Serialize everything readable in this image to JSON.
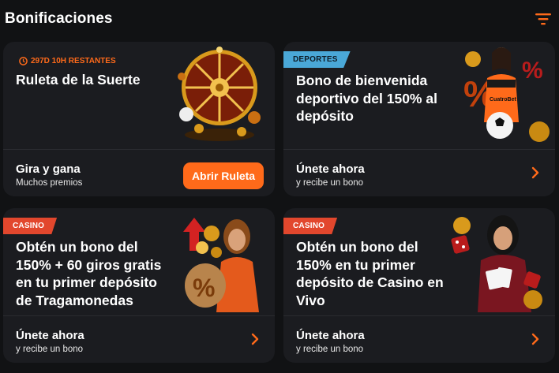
{
  "header": {
    "title": "Bonificaciones",
    "filter_icon": "filter-icon"
  },
  "colors": {
    "accent": "#ff6a1a",
    "sport_tag": "#4aa8d8",
    "casino_tag": "#e2472d",
    "card_bg": "#1b1c20",
    "page_bg": "#111214"
  },
  "cards": [
    {
      "timer": "297D 10H RESTANTES",
      "title_lines": [
        "Ruleta de la Suerte"
      ],
      "footer_main": "Gira y gana",
      "footer_sub": "Muchos premios",
      "button_label": "Abrir Ruleta",
      "image": "roulette-wheel"
    },
    {
      "tag": "DEPORTES",
      "title_lines": [
        "Bono de bienvenida",
        "deportivo del 150% al",
        "depósito"
      ],
      "footer_main": "Únete ahora",
      "footer_sub": "y recibe un bono",
      "image": "sports-woman",
      "jersey_text": "CuatroBet"
    },
    {
      "tag": "CASINO",
      "title_lines": [
        "Obtén un bono del",
        "150% + 60 giros gratis",
        "en tu primer depósito",
        "de Tragamonedas"
      ],
      "footer_main": "Únete ahora",
      "footer_sub": "y recibe un bono",
      "image": "slots-woman"
    },
    {
      "tag": "CASINO",
      "title_lines": [
        "Obtén un bono del",
        "150% en tu primer",
        "depósito de Casino en",
        "Vivo"
      ],
      "footer_main": "Únete ahora",
      "footer_sub": "y recibe un bono",
      "image": "live-casino-woman"
    }
  ]
}
